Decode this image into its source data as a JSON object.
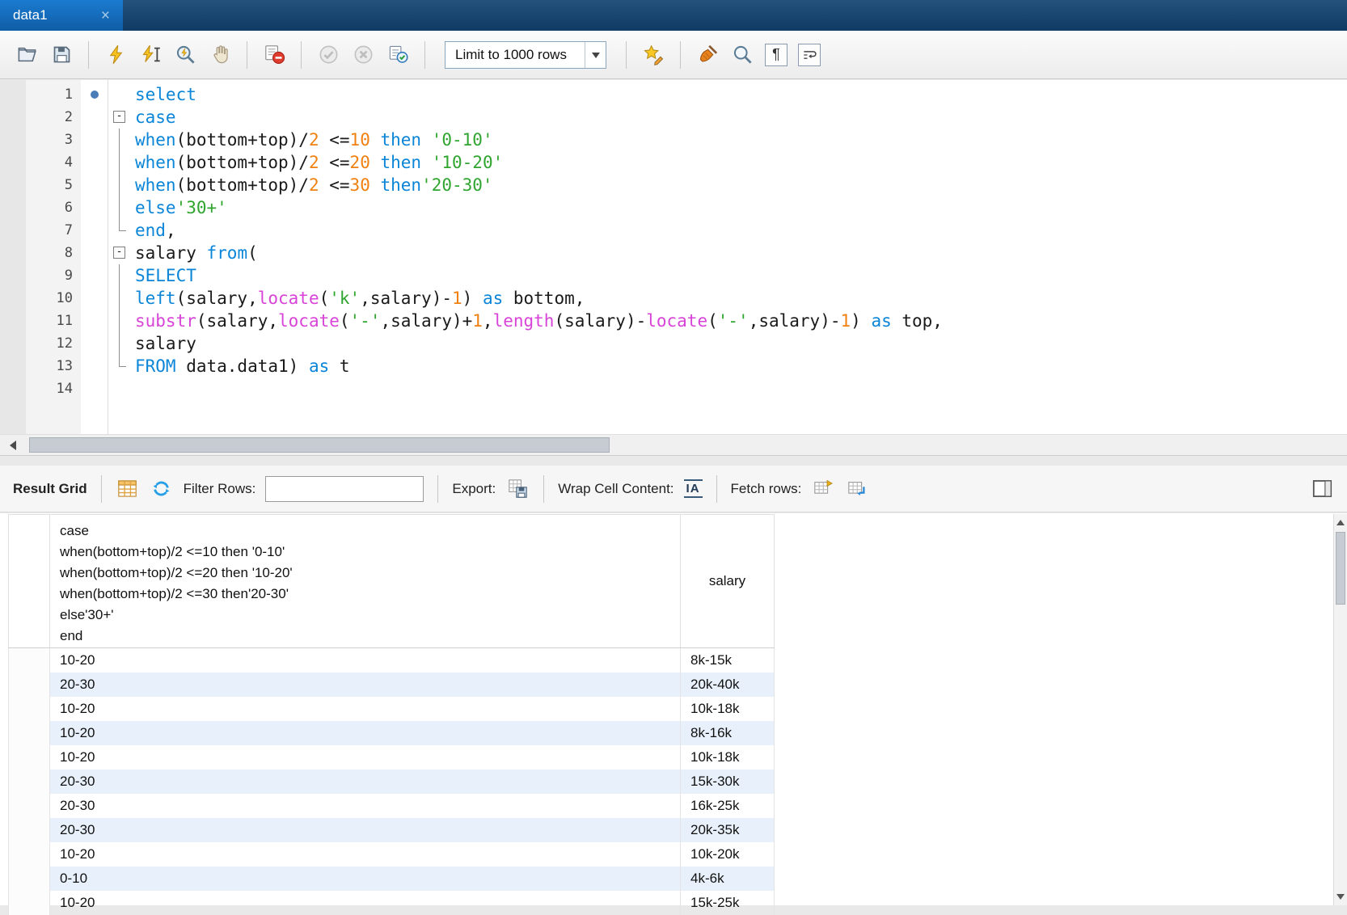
{
  "tab": {
    "title": "data1"
  },
  "toolbar": {
    "limit_label": "Limit to 1000 rows"
  },
  "icons": {
    "close": "×",
    "pilcrow": "¶",
    "wrap_cell": "IA"
  },
  "colors": {
    "keyword": "#0a85d8",
    "function": "#d843d8",
    "string": "#2fa52f",
    "number": "#f08010",
    "text": "#1a1a1a",
    "row_alt": "#e8f1fb",
    "tab_active": "#1070c0"
  },
  "editor": {
    "lines": [
      {
        "n": 1,
        "dot": true,
        "segs": [
          [
            "kw",
            "select"
          ]
        ]
      },
      {
        "n": 2,
        "fold": "box",
        "segs": [
          [
            "kw",
            "case"
          ]
        ]
      },
      {
        "n": 3,
        "fold": "line",
        "segs": [
          [
            "kw",
            "when"
          ],
          [
            "pl",
            "(bottom+top)/"
          ],
          [
            "num",
            "2"
          ],
          [
            "pl",
            " <="
          ],
          [
            "num",
            "10"
          ],
          [
            "pl",
            " "
          ],
          [
            "kw",
            "then"
          ],
          [
            "pl",
            " "
          ],
          [
            "str",
            "'0-10'"
          ]
        ]
      },
      {
        "n": 4,
        "fold": "line",
        "segs": [
          [
            "kw",
            "when"
          ],
          [
            "pl",
            "(bottom+top)/"
          ],
          [
            "num",
            "2"
          ],
          [
            "pl",
            " <="
          ],
          [
            "num",
            "20"
          ],
          [
            "pl",
            " "
          ],
          [
            "kw",
            "then"
          ],
          [
            "pl",
            " "
          ],
          [
            "str",
            "'10-20'"
          ]
        ]
      },
      {
        "n": 5,
        "fold": "line",
        "segs": [
          [
            "kw",
            "when"
          ],
          [
            "pl",
            "(bottom+top)/"
          ],
          [
            "num",
            "2"
          ],
          [
            "pl",
            " <="
          ],
          [
            "num",
            "30"
          ],
          [
            "pl",
            " "
          ],
          [
            "kw",
            "then"
          ],
          [
            "str",
            "'20-30'"
          ]
        ]
      },
      {
        "n": 6,
        "fold": "line",
        "segs": [
          [
            "kw",
            "else"
          ],
          [
            "str",
            "'30+'"
          ]
        ]
      },
      {
        "n": 7,
        "fold": "end",
        "segs": [
          [
            "kw",
            "end"
          ],
          [
            "pl",
            ","
          ]
        ]
      },
      {
        "n": 8,
        "fold": "box",
        "segs": [
          [
            "pl",
            "salary "
          ],
          [
            "kw",
            "from"
          ],
          [
            "pl",
            "("
          ]
        ]
      },
      {
        "n": 9,
        "fold": "line",
        "segs": [
          [
            "kw",
            "SELECT"
          ]
        ]
      },
      {
        "n": 10,
        "fold": "line",
        "segs": [
          [
            "kw",
            "left"
          ],
          [
            "pl",
            "(salary,"
          ],
          [
            "fn",
            "locate"
          ],
          [
            "pl",
            "("
          ],
          [
            "str",
            "'k'"
          ],
          [
            "pl",
            ",salary)-"
          ],
          [
            "num",
            "1"
          ],
          [
            "pl",
            ") "
          ],
          [
            "kw",
            "as"
          ],
          [
            "pl",
            " bottom,"
          ]
        ]
      },
      {
        "n": 11,
        "fold": "line",
        "segs": [
          [
            "fn",
            "substr"
          ],
          [
            "pl",
            "(salary,"
          ],
          [
            "fn",
            "locate"
          ],
          [
            "pl",
            "("
          ],
          [
            "str",
            "'-'"
          ],
          [
            "pl",
            ",salary)+"
          ],
          [
            "num",
            "1"
          ],
          [
            "pl",
            ","
          ],
          [
            "fn",
            "length"
          ],
          [
            "pl",
            "(salary)-"
          ],
          [
            "fn",
            "locate"
          ],
          [
            "pl",
            "("
          ],
          [
            "str",
            "'-'"
          ],
          [
            "pl",
            ",salary)-"
          ],
          [
            "num",
            "1"
          ],
          [
            "pl",
            ") "
          ],
          [
            "kw",
            "as"
          ],
          [
            "pl",
            " top,"
          ]
        ]
      },
      {
        "n": 12,
        "fold": "line",
        "segs": [
          [
            "pl",
            "salary"
          ]
        ]
      },
      {
        "n": 13,
        "fold": "end",
        "segs": [
          [
            "kw",
            "FROM"
          ],
          [
            "pl",
            " data.data1) "
          ],
          [
            "kw",
            "as"
          ],
          [
            "pl",
            " t"
          ]
        ]
      },
      {
        "n": 14,
        "segs": []
      }
    ]
  },
  "result_toolbar": {
    "title": "Result Grid",
    "filter_label": "Filter Rows:",
    "filter_value": "",
    "export_label": "Export:",
    "wrap_label": "Wrap Cell Content:",
    "fetch_label": "Fetch rows:"
  },
  "grid": {
    "header_case_lines": [
      "case",
      "when(bottom+top)/2 <=10 then '0-10'",
      "when(bottom+top)/2 <=20 then '10-20'",
      "when(bottom+top)/2 <=30 then'20-30'",
      "else'30+'",
      "end"
    ],
    "header_salary": "salary",
    "rows": [
      [
        "10-20",
        "8k-15k"
      ],
      [
        "20-30",
        "20k-40k"
      ],
      [
        "10-20",
        "10k-18k"
      ],
      [
        "10-20",
        "8k-16k"
      ],
      [
        "10-20",
        "10k-18k"
      ],
      [
        "20-30",
        "15k-30k"
      ],
      [
        "20-30",
        "16k-25k"
      ],
      [
        "20-30",
        "20k-35k"
      ],
      [
        "10-20",
        "10k-20k"
      ],
      [
        "0-10",
        "4k-6k"
      ],
      [
        "10-20",
        "15k-25k"
      ]
    ]
  }
}
